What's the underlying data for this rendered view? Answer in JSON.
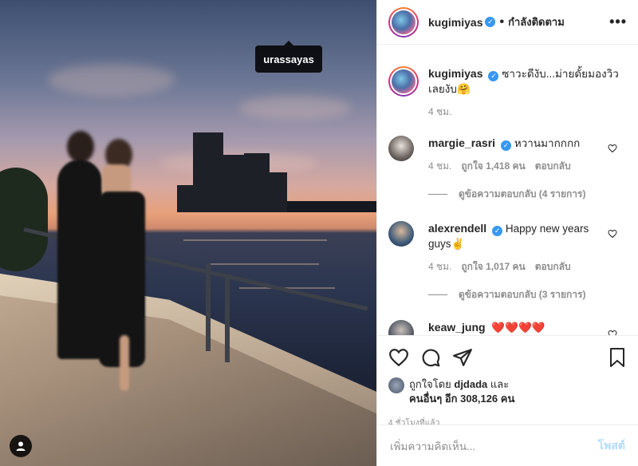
{
  "photo": {
    "tag_username": "urassayas"
  },
  "post": {
    "author": "kugimiyas",
    "follow_label": "กำลังติดตาม",
    "caption": "ซาวะดีงับ...ม่ายดั้ยมองวิวเลยงับ🤗",
    "caption_time": "4 ชม.",
    "more_label": "•••"
  },
  "comments": [
    {
      "username": "margie_rasri",
      "verified": true,
      "text": "หวานมากกกก",
      "time": "4 ชม.",
      "likes": "ถูกใจ 1,418 คน",
      "reply_label": "ตอบกลับ",
      "view_replies": "ดูข้อความตอบกลับ (4 รายการ)"
    },
    {
      "username": "alexrendell",
      "verified": true,
      "text": "Happy new years guys✌️",
      "time": "4 ชม.",
      "likes": "ถูกใจ 1,017 คน",
      "reply_label": "ตอบกลับ",
      "view_replies": "ดูข้อความตอบกลับ (3 รายการ)"
    },
    {
      "username": "keaw_jung",
      "verified": false,
      "text": "❤️❤️❤️❤️"
    }
  ],
  "likes": {
    "prefix": "ถูกใจโดย",
    "liker": "djdada",
    "and": "และ",
    "others": "คนอื่นๆ อีก 308,126 คน"
  },
  "posted_time": "4 ชั่วโมงที่แล้ว",
  "add_comment": {
    "placeholder": "เพิ่มความคิดเห็น...",
    "post_label": "โพสต์"
  }
}
